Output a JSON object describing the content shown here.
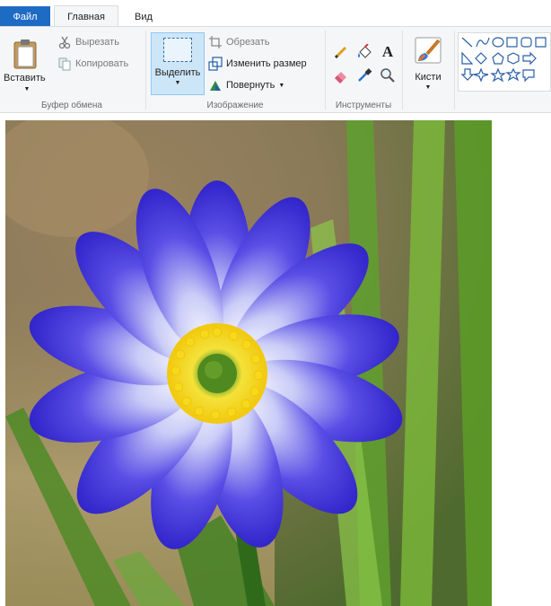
{
  "tabs": {
    "file": "Файл",
    "home": "Главная",
    "view": "Вид"
  },
  "clipboard": {
    "paste": "Вставить",
    "cut": "Вырезать",
    "copy": "Копировать",
    "group_label": "Буфер обмена"
  },
  "image": {
    "select": "Выделить",
    "crop": "Обрезать",
    "resize": "Изменить размер",
    "rotate": "Повернуть",
    "group_label": "Изображение"
  },
  "tools": {
    "group_label": "Инструменты",
    "text_tool_glyph": "A"
  },
  "brushes": {
    "label": "Кисти"
  },
  "colors": {
    "file_tab": "#1e6bc4",
    "ribbon_bg": "#f5f6f7",
    "select_active": "#cde6f7",
    "petal_blue": "#3b2fd6",
    "flower_center": "#f4d81c",
    "leaf_green": "#3f8f2a"
  }
}
